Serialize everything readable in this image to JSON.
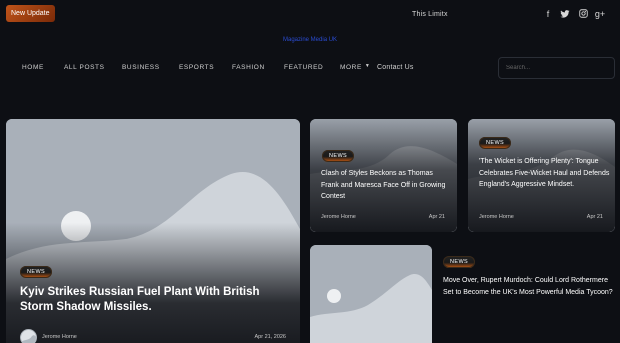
{
  "topbar": {
    "update_badge": "New Update",
    "ticker": "This Limitx",
    "social": [
      {
        "icon": "facebook-icon",
        "glyph": "f"
      },
      {
        "icon": "twitter-icon",
        "glyph": "🐦"
      },
      {
        "icon": "instagram-icon",
        "glyph": "◎"
      },
      {
        "icon": "google-plus-icon",
        "glyph": "g+"
      }
    ]
  },
  "site": {
    "title": "Magazine Media UK"
  },
  "nav": {
    "items": [
      "HOME",
      "ALL POSTS",
      "BUSINESS",
      "ESPORTS",
      "FASHION",
      "FEATURED",
      "MORE",
      "Contact Us"
    ],
    "search_placeholder": "Search..."
  },
  "posts": {
    "main": {
      "tag": "News",
      "title": "Kyiv Strikes Russian Fuel Plant With British Storm Shadow Missiles.",
      "author": "Jerome Horne",
      "date": "Apr 21, 2026"
    },
    "card2": {
      "tag": "News",
      "title": "Clash of Styles Beckons as Thomas Frank and Maresca Face Off in Growing Contest",
      "author": "Jerome Horne",
      "date": "Apr 21"
    },
    "card3": {
      "tag": "News",
      "title": "'The Wicket is Offering Plenty': Tongue Celebrates Five-Wicket Haul and Defends England's Aggressive Mindset.",
      "author": "Jerome Horne",
      "date": "Apr 21"
    },
    "card4": {
      "tag": "News",
      "title": "Move Over, Rupert Murdoch: Could Lord Rothermere Set to Become the UK's Most Powerful Media Tycoon?"
    }
  },
  "colors": {
    "accent": "#c0541a",
    "background": "#0d0f14",
    "link": "#2a4bd0"
  }
}
